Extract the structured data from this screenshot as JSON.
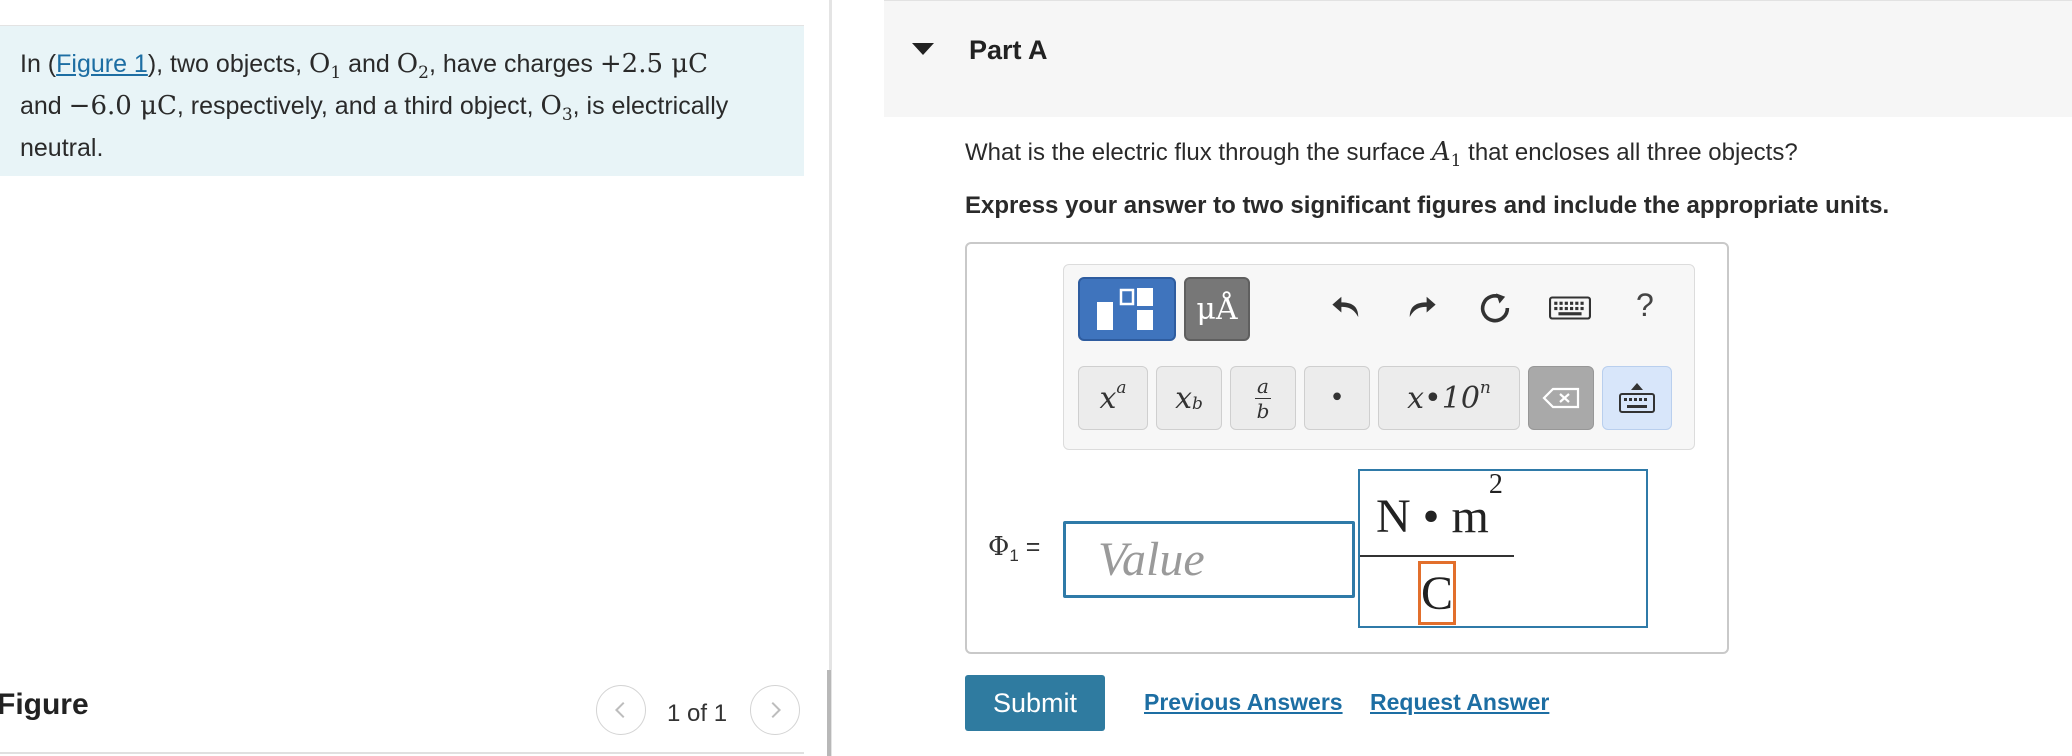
{
  "intro": {
    "prefix": "In (",
    "figure_link": "Figure 1",
    "middle1": "), two objects, ",
    "o1": "O",
    "o1_sub": "1",
    "and": " and ",
    "o2": "O",
    "o2_sub": "2",
    "middle2": ", have charges ",
    "charge1": "+2.5 μC",
    "line2_prefix": "and ",
    "charge2": "−6.0 μC",
    "middle3": ", respectively, and a third object, ",
    "o3": "O",
    "o3_sub": "3",
    "suffix": ", is electrically neutral."
  },
  "figure": {
    "title": "Figure",
    "pager_text": "1 of 1"
  },
  "part": {
    "title": "Part A"
  },
  "question": {
    "prefix": "What is the electric flux through the surface ",
    "surface": "A",
    "surface_sub": "1",
    "suffix": " that encloses all three objects?",
    "instruction": "Express your answer to two significant figures and include the appropriate units."
  },
  "toolbar": {
    "units_label": "μÅ",
    "help_label": "?",
    "sup_key": "x",
    "sup_key_exp": "a",
    "sub_key": "x",
    "sub_key_sub": "b",
    "frac_num": "a",
    "frac_den": "b",
    "dot_key": "•",
    "sci_key": "x•10",
    "sci_key_exp": "n"
  },
  "answer": {
    "label": "Φ",
    "label_sub": "1",
    "equals": " =",
    "placeholder": "Value",
    "unit_numerator": "N • m",
    "unit_numerator_exp": "2",
    "unit_denominator": "C"
  },
  "actions": {
    "submit": "Submit",
    "previous_answers": "Previous Answers",
    "request_answer": "Request Answer"
  }
}
